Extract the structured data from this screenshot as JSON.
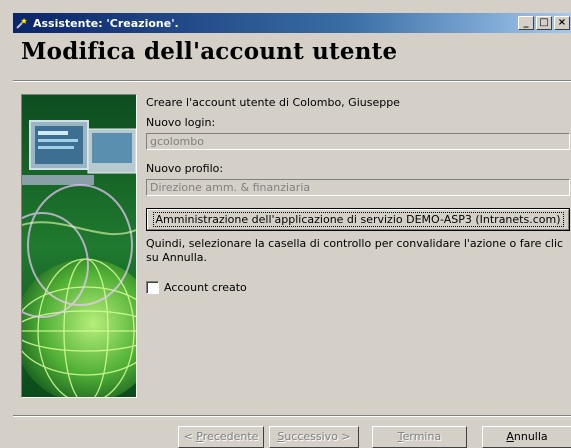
{
  "window": {
    "title": "Assistente: 'Creazione'.",
    "minimize_glyph": "_",
    "maximize_glyph": "□",
    "close_glyph": "×"
  },
  "heading": "Modifica dell'account utente",
  "content": {
    "intro": "Creare l'account utente di Colombo, Giuseppe",
    "login_label": "Nuovo login:",
    "login_value": "gcolombo",
    "profile_label": "Nuovo profilo:",
    "profile_value": "Direzione amm. & finanziaria",
    "action_button": "Amministrazione dell'applicazione di servizio DEMO-ASP3 (Intranets.com)",
    "instruction_line1": "Quindi, selezionare la casella di controllo per convalidare l'azione o fare clic",
    "instruction_line2": "su Annulla.",
    "checkbox_label": "Account creato"
  },
  "buttons": {
    "prev_prefix": "< ",
    "prev_hotkey": "P",
    "prev_rest": "recedente",
    "next_hotkey": "S",
    "next_rest": "uccessivo >",
    "finish_hotkey": "T",
    "finish_rest": "ermina",
    "cancel_hotkey": "A",
    "cancel_rest": "nnulla"
  },
  "icons": {
    "app": "wizard-icon",
    "image": "wizard-globe-computer-image"
  }
}
